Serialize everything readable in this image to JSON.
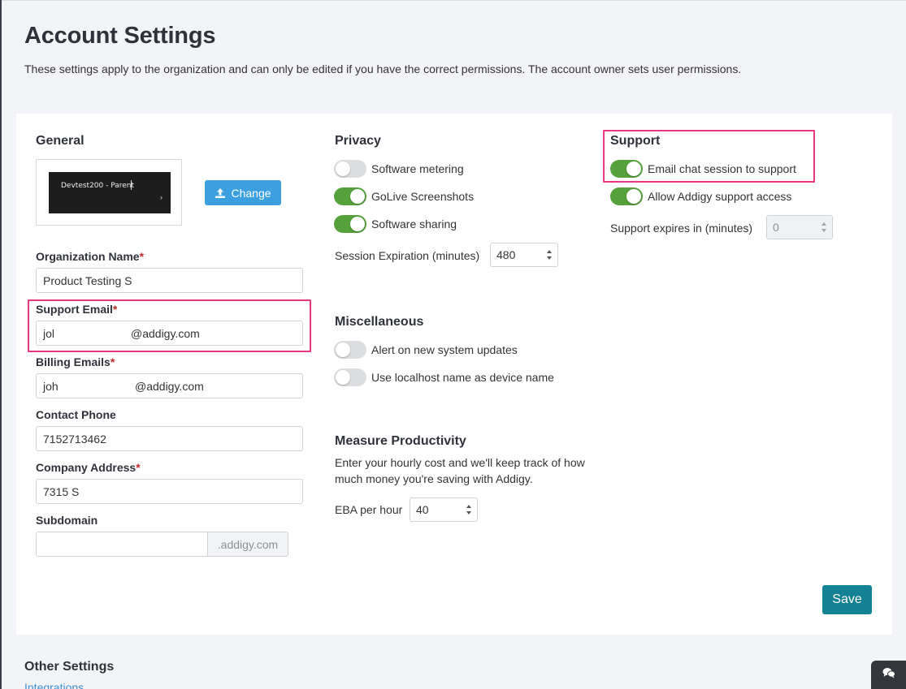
{
  "header": {
    "title": "Account Settings",
    "description": "These settings apply to the organization and can only be edited if you have the correct permissions. The account owner sets user permissions."
  },
  "general": {
    "title": "General",
    "logo_text": "Devtest200 - Parent",
    "change_label": "Change",
    "fields": {
      "org_name": {
        "label": "Organization Name",
        "value": "Product Testing S"
      },
      "support_email": {
        "label": "Support Email",
        "value_prefix": "jol",
        "value_suffix": "@addigy.com"
      },
      "billing_emails": {
        "label": "Billing Emails",
        "value_prefix": "joh",
        "value_suffix": "@addigy.com"
      },
      "contact_phone": {
        "label": "Contact Phone",
        "value": "7152713462"
      },
      "company_address": {
        "label": "Company Address",
        "value": "7315 S"
      },
      "subdomain": {
        "label": "Subdomain",
        "value": "",
        "suffix": ".addigy.com"
      }
    },
    "required_marker": "*"
  },
  "privacy": {
    "title": "Privacy",
    "toggles": [
      {
        "label": "Software metering",
        "on": false
      },
      {
        "label": "GoLive Screenshots",
        "on": true
      },
      {
        "label": "Software sharing",
        "on": true
      }
    ],
    "session_label": "Session Expiration (minutes)",
    "session_value": "480"
  },
  "misc": {
    "title": "Miscellaneous",
    "toggles": [
      {
        "label": "Alert on new system updates",
        "on": false
      },
      {
        "label": "Use localhost name as device name",
        "on": false
      }
    ]
  },
  "productivity": {
    "title": "Measure Productivity",
    "description": "Enter your hourly cost and we'll keep track of how much money you're saving with Addigy.",
    "eba_label": "EBA per hour",
    "eba_value": "40"
  },
  "support": {
    "title": "Support",
    "toggles": [
      {
        "label": "Email chat session to support",
        "on": true
      },
      {
        "label": "Allow Addigy support access",
        "on": true
      }
    ],
    "expires_label": "Support expires in (minutes)",
    "expires_value": "0"
  },
  "actions": {
    "save_label": "Save"
  },
  "other": {
    "title": "Other Settings",
    "integrations_label": "Integrations"
  },
  "colors": {
    "toggle_on": "#55a13c",
    "toggle_off": "#dcdde0",
    "save_button": "#128294",
    "change_button": "#3b9fe0",
    "highlight": "#e8367f",
    "required": "#c62828"
  },
  "icons": {
    "upload": "upload-icon",
    "chat": "chat-icon"
  }
}
